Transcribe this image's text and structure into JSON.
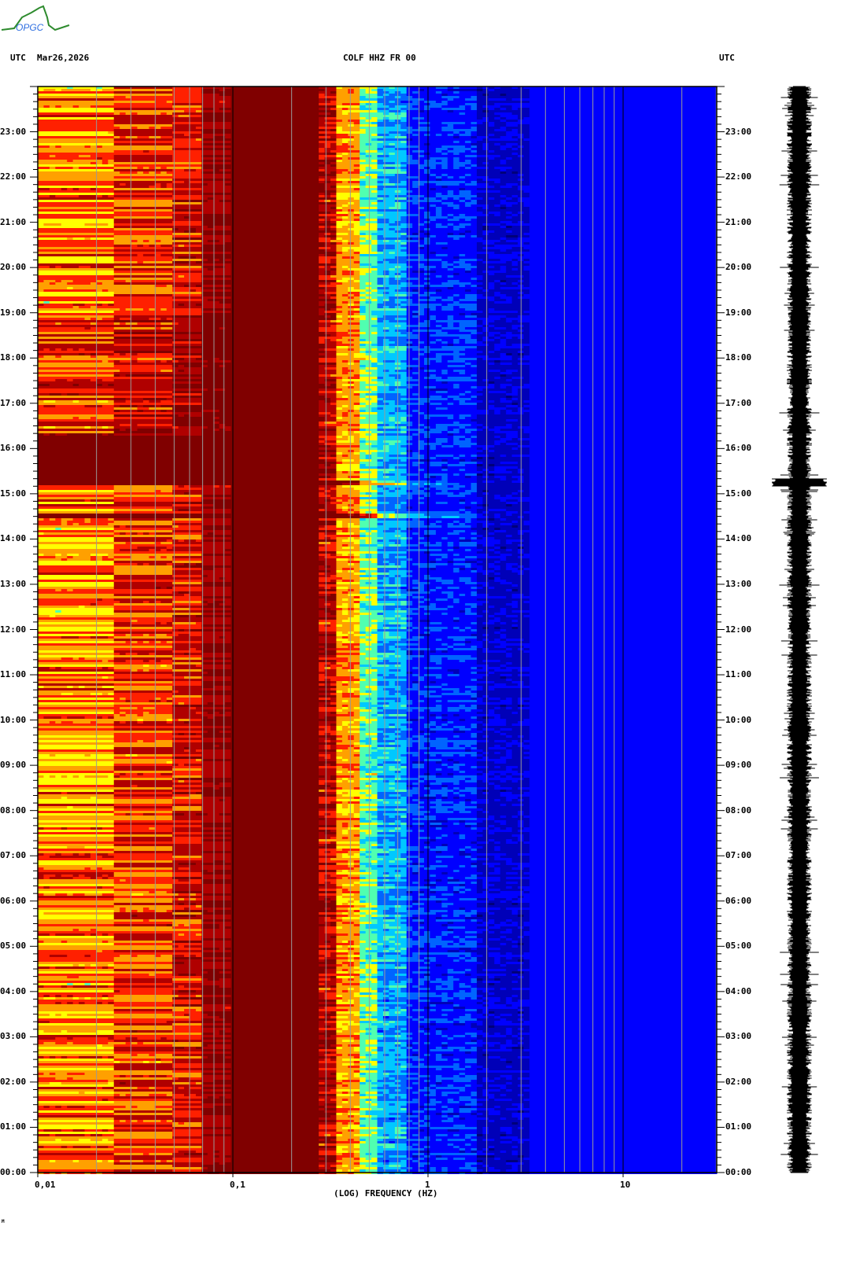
{
  "header": {
    "logo_text": "OPGC",
    "left_tz": "UTC",
    "date": "Mar26,2026",
    "station": "COLF HHZ FR 00",
    "right_tz": "UTC"
  },
  "footer_mark": "M",
  "chart_data": {
    "type": "heatmap",
    "title": "COLF HHZ FR 00",
    "xlabel": "(LOG) FREQUENCY (HZ)",
    "x_scale": "log",
    "xlim": [
      0.01,
      30
    ],
    "x_ticks": [
      {
        "v": 0.01,
        "label": "0,01"
      },
      {
        "v": 0.1,
        "label": "0,1"
      },
      {
        "v": 1,
        "label": "1"
      },
      {
        "v": 10,
        "label": "10"
      }
    ],
    "ylabel": "UTC",
    "ylim_hours": [
      0,
      24
    ],
    "y_ticks": [
      "00:00",
      "01:00",
      "02:00",
      "03:00",
      "04:00",
      "05:00",
      "06:00",
      "07:00",
      "08:00",
      "09:00",
      "10:00",
      "11:00",
      "12:00",
      "13:00",
      "14:00",
      "15:00",
      "16:00",
      "17:00",
      "18:00",
      "19:00",
      "20:00",
      "21:00",
      "22:00",
      "23:00"
    ],
    "colormap": [
      "#00007a",
      "#0000b8",
      "#0000ff",
      "#0064ff",
      "#00c8ff",
      "#50ffb0",
      "#ffff00",
      "#ffa000",
      "#ff2000",
      "#b00000",
      "#800000"
    ],
    "bands_hz_level": [
      {
        "f": [
          0.01,
          0.025
        ],
        "level": 7.2,
        "streak": 1.6
      },
      {
        "f": [
          0.025,
          0.05
        ],
        "level": 8.0,
        "streak": 1.4
      },
      {
        "f": [
          0.05,
          0.07
        ],
        "level": 8.4,
        "streak": 1.3
      },
      {
        "f": [
          0.07,
          0.1
        ],
        "level": 9.4,
        "streak": 0.8
      },
      {
        "f": [
          0.1,
          0.28
        ],
        "level": 10,
        "streak": 0
      },
      {
        "f": [
          0.28,
          0.35
        ],
        "level": 9.0,
        "streak": 1.2
      },
      {
        "f": [
          0.35,
          0.45
        ],
        "level": 7.0,
        "streak": 0.8
      },
      {
        "f": [
          0.45,
          0.56
        ],
        "level": 5.2,
        "streak": 0.8
      },
      {
        "f": [
          0.56,
          0.8
        ],
        "level": 3.8,
        "streak": 0.8
      },
      {
        "f": [
          0.8,
          1.8
        ],
        "level": 2.3,
        "streak": 0.5
      },
      {
        "f": [
          1.8,
          3.2
        ],
        "level": 1.3,
        "streak": 0.4
      },
      {
        "f": [
          3.2,
          30
        ],
        "level": 1.9,
        "streak": 0.1
      }
    ],
    "saturated_period_hours": [
      15.2,
      16.3
    ],
    "events": [
      {
        "time": "15:15",
        "max_freq_hz": 1.5
      },
      {
        "time": "14:32",
        "max_freq_hz": 1.9
      }
    ],
    "waveform_trace": {
      "channel": "HHZ",
      "spike_time": "15:15"
    }
  }
}
